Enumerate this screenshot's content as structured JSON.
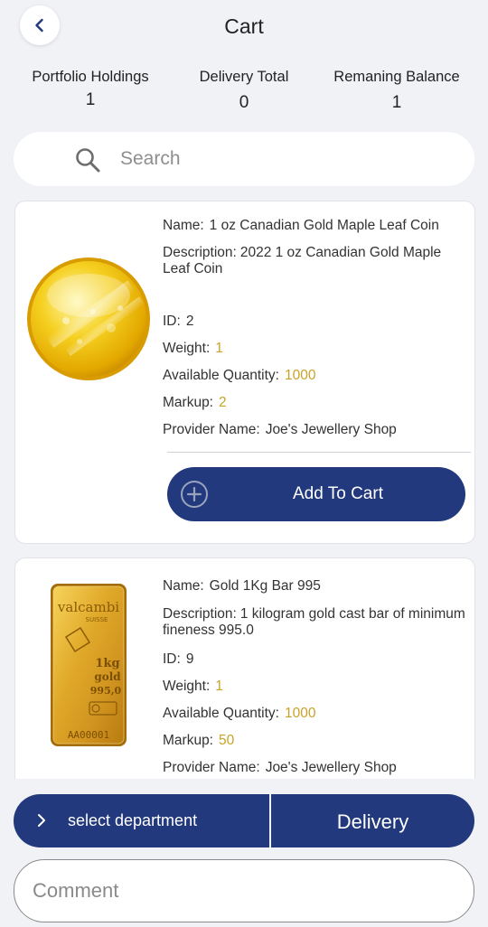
{
  "header": {
    "title": "Cart"
  },
  "stats": [
    {
      "label": "Portfolio Holdings",
      "value": "1"
    },
    {
      "label": "Delivery Total",
      "value": "0"
    },
    {
      "label": "Remaning Balance",
      "value": "1"
    }
  ],
  "search": {
    "placeholder": "Search"
  },
  "products": [
    {
      "name_key": "Name:",
      "name": "1 oz Canadian Gold Maple Leaf Coin",
      "desc_key": "Description:",
      "desc": "2022 1 oz Canadian Gold Maple Leaf Coin",
      "id_key": "ID:",
      "id": "2",
      "weight_key": "Weight:",
      "weight": "1",
      "qty_key": "Available Quantity:",
      "qty": "1000",
      "markup_key": "Markup:",
      "markup": "2",
      "provider_key": "Provider Name:",
      "provider": "Joe's Jewellery Shop",
      "add_label": "Add To Cart"
    },
    {
      "name_key": "Name:",
      "name": "Gold 1Kg Bar 995",
      "desc_key": "Description:",
      "desc": "1 kilogram gold cast bar of minimum fineness 995.0",
      "id_key": "ID:",
      "id": "9",
      "weight_key": "Weight:",
      "weight": "1",
      "qty_key": "Available Quantity:",
      "qty": "1000",
      "markup_key": "Markup:",
      "markup": "50",
      "provider_key": "Provider Name:",
      "provider": "Joe's Jewellery Shop",
      "bar_brand": "valcambi",
      "bar_sub": "SUISSE",
      "bar_weight": "1kg",
      "bar_metal": "gold",
      "bar_fineness": "995,0",
      "bar_serial": "AA00001"
    }
  ],
  "footer": {
    "department_label": "select department",
    "delivery_label": "Delivery",
    "comment_placeholder": "Comment"
  },
  "colors": {
    "primary": "#22397d",
    "accent_gold": "#c9a227",
    "background": "#f1f2f6"
  }
}
